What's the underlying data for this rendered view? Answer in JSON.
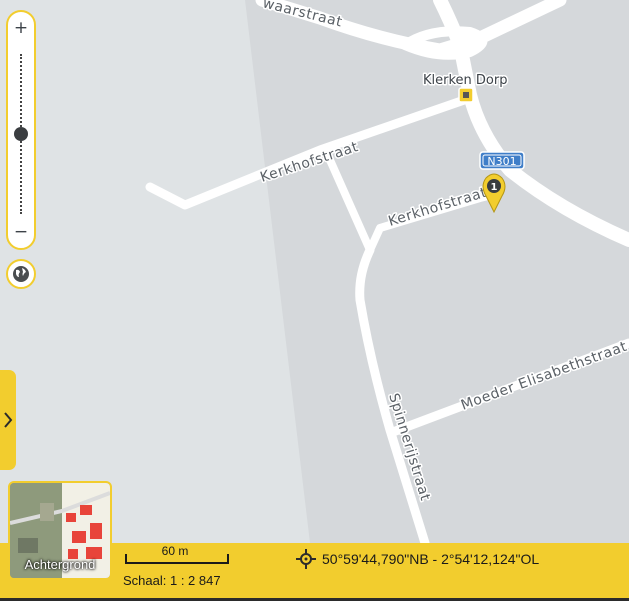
{
  "map": {
    "streets": [
      {
        "name": "waarstraat"
      },
      {
        "name": "Kerkhofstraat"
      },
      {
        "name": "Kerkhofstraat"
      },
      {
        "name": "Moeder Elisabethstraat"
      },
      {
        "name": "Spinnerijstraat"
      }
    ],
    "poi": {
      "label": "Klerken Dorp",
      "icon": "bus-stop-icon"
    },
    "road_shield": {
      "label": "N301",
      "color": "#3f7ec8"
    },
    "marker": {
      "label": "1",
      "color": "#f2cd2e",
      "icon": "map-pin-icon"
    }
  },
  "controls": {
    "zoom_in": "+",
    "zoom_out": "−",
    "zoom_level_fraction": 0.5,
    "globe_icon": "globe-icon",
    "side_toggle_icon": "chevron-right-icon"
  },
  "footer": {
    "background_label": "Achtergrond",
    "scale_distance": "60 m",
    "scale_text": "Schaal: 1 : 2 847",
    "coordinates": "50°59'44,790\"NB - 2°54'12,124\"OL",
    "coord_icon": "crosshair-icon"
  },
  "colors": {
    "accent": "#f2cd2e",
    "shield": "#3f7ec8"
  }
}
